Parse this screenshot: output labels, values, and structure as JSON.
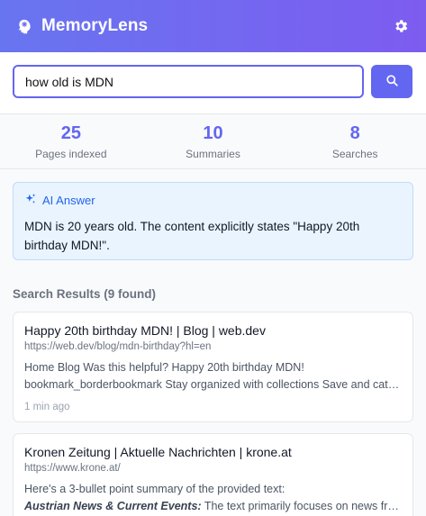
{
  "header": {
    "title": "MemoryLens",
    "logo_icon": "brain-icon",
    "settings_icon": "gear-icon"
  },
  "search": {
    "value": "how old is MDN",
    "button_icon": "search-icon"
  },
  "stats": [
    {
      "value": "25",
      "label": "Pages indexed"
    },
    {
      "value": "10",
      "label": "Summaries"
    },
    {
      "value": "8",
      "label": "Searches"
    }
  ],
  "ai_answer": {
    "heading": "AI Answer",
    "icon": "sparkles-icon",
    "text": "MDN is 20 years old. The content explicitly states \"Happy 20th birthday MDN!\"."
  },
  "results": {
    "heading": "Search Results (9 found)",
    "items": [
      {
        "title": "Happy 20th birthday MDN!  |  Blog  |  web.dev",
        "url": "https://web.dev/blog/mdn-birthday?hl=en",
        "snippet_line1": "Home Blog Was this helpful? Happy 20th birthday MDN!",
        "snippet_line2": "bookmark_borderbookmark Stay organized with collections Save and categorize content based on your preferences.",
        "time": "1 min ago"
      },
      {
        "title": "Kronen Zeitung | Aktuelle Nachrichten | krone.at",
        "url": "https://www.krone.at/",
        "snippet_line1": "Here's a 3-bullet point summary of the provided text:",
        "snippet_bold": "Austrian News & Current Events:",
        "snippet_rest": " The text primarily focuses on news from Austria."
      }
    ]
  },
  "colors": {
    "accent": "#6366f1",
    "header_start": "#6875f0",
    "header_end": "#7d5cf0",
    "ai_bg": "#e9f4fe",
    "ai_accent": "#2563eb"
  }
}
